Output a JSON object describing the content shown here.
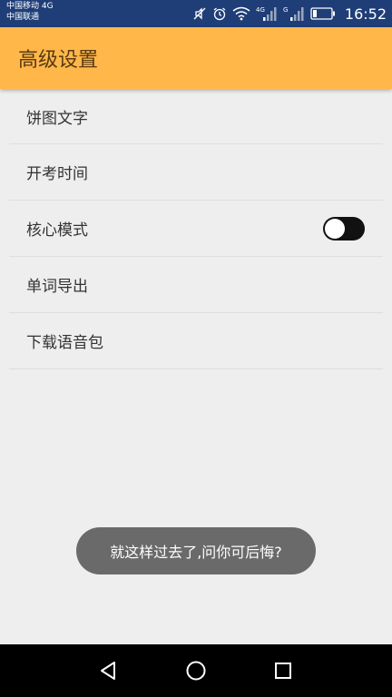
{
  "status_bar": {
    "carrier_1": "中国移动 4G",
    "carrier_2": "中国联通",
    "signal_1_label": "4G",
    "signal_2_label": "G",
    "time": "16:52",
    "icons": [
      "mute-icon",
      "alarm-icon",
      "wifi-icon",
      "signal-4g-icon",
      "signal-g-icon",
      "battery-icon"
    ]
  },
  "app_bar": {
    "title": "高级设置",
    "color": "#ffb74a"
  },
  "settings": {
    "items": [
      {
        "label": "饼图文字"
      },
      {
        "label": "开考时间"
      },
      {
        "label": "核心模式",
        "toggle": "off"
      },
      {
        "label": "单词导出"
      },
      {
        "label": "下载语音包"
      }
    ]
  },
  "toast": {
    "message": "就这样过去了,问你可后悔?"
  },
  "nav_bar": {
    "icons": [
      "back-icon",
      "home-icon",
      "recents-icon"
    ]
  }
}
